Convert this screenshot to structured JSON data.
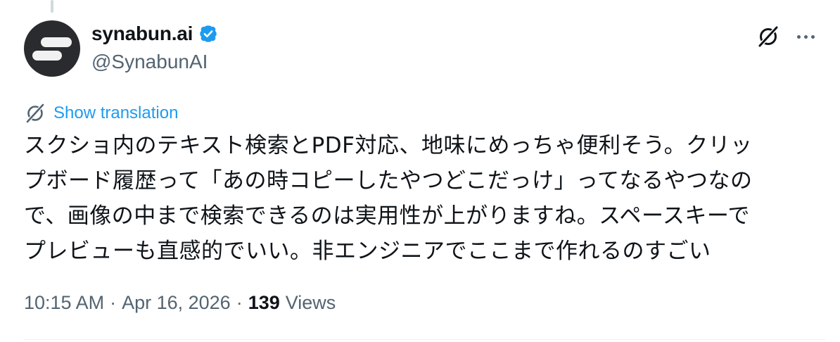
{
  "author": {
    "display_name": "synabun.ai",
    "handle": "@SynabunAI",
    "verified": true,
    "avatar_icon": "synabun-logo"
  },
  "actions": {
    "grok_icon": "grok-icon",
    "more_icon": "more-icon"
  },
  "translate": {
    "label": "Show translation",
    "icon": "translate-icon"
  },
  "tweet": {
    "lines": [
      "スクショ内のテキスト検索とPDF対応、地味にめっちゃ便利そう。クリッ",
      "プボード履歴って「あの時コピーしたやつどこだっけ」ってなるやつなの",
      "で、画像の中まで検索できるのは実用性が上がりますね。スペースキーで",
      "プレビューも直感的でいい。非エンジニアでここまで作れるのすごい"
    ]
  },
  "meta": {
    "time": "10:15 AM",
    "separator1": "·",
    "date": "Apr 16, 2026",
    "separator2": "·",
    "views_count": "139",
    "views_label": "Views"
  },
  "colors": {
    "text_primary": "#0f1419",
    "text_secondary": "#536471",
    "link": "#1d9bf0",
    "verified_badge": "#1d9bf0",
    "avatar_bg": "#2a2b2e"
  }
}
